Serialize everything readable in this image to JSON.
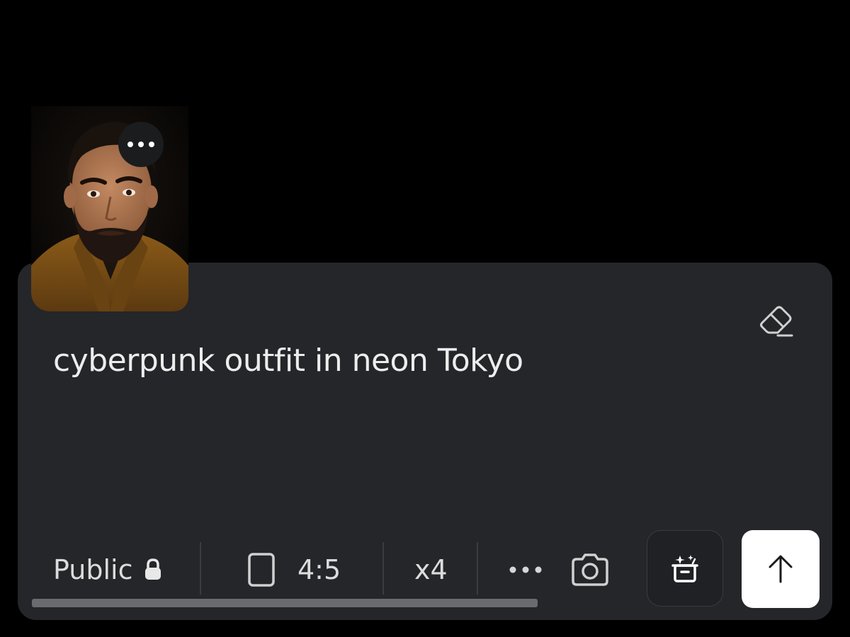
{
  "prompt": {
    "text": "cyberpunk outfit in neon Tokyo"
  },
  "avatar": {
    "icon": "person-photo",
    "menu_icon": "more-horizontal-icon"
  },
  "toolbar": {
    "visibility_label": "Public",
    "visibility_icon": "lock-icon",
    "aspect_icon": "portrait-rectangle-icon",
    "aspect_label": "4:5",
    "count_label": "x4",
    "more_icon": "more-horizontal-icon",
    "camera_icon": "camera-icon",
    "archive_icon": "sparkle-box-icon",
    "send_icon": "arrow-up-icon",
    "eraser_icon": "eraser-icon"
  },
  "colors": {
    "background": "#000000",
    "card": "#25262a",
    "text": "#ededed",
    "send_button": "#ffffff",
    "scrollbar": "#6a6b6e"
  }
}
